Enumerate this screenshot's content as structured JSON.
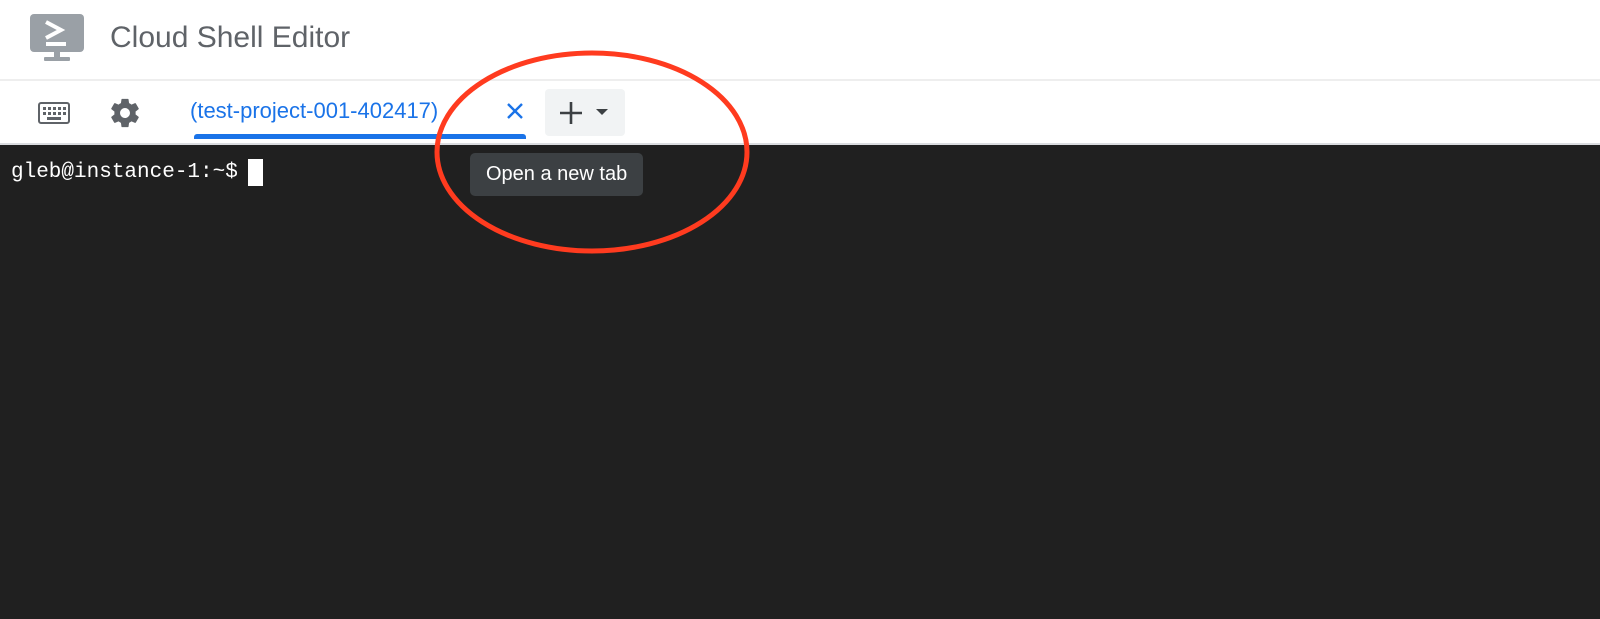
{
  "header": {
    "app_title": "Cloud Shell Editor",
    "logo_icon": "cloud-shell-terminal-icon"
  },
  "toolbar": {
    "keyboard_icon": "keyboard-icon",
    "settings_icon": "gear-icon"
  },
  "tabs": [
    {
      "label": "(test-project-001-402417)",
      "active": true,
      "close_icon": "close-icon"
    }
  ],
  "new_tab": {
    "plus_icon": "plus-icon",
    "caret_icon": "caret-down-icon",
    "tooltip": "Open a new tab"
  },
  "terminal": {
    "prompt": "gleb@instance-1:~$"
  },
  "colors": {
    "accent": "#1a73e8",
    "terminal_bg": "#202020",
    "tooltip_bg": "#3c4043",
    "annotation": "#ff3b1f",
    "title_gray": "#5f6368"
  }
}
